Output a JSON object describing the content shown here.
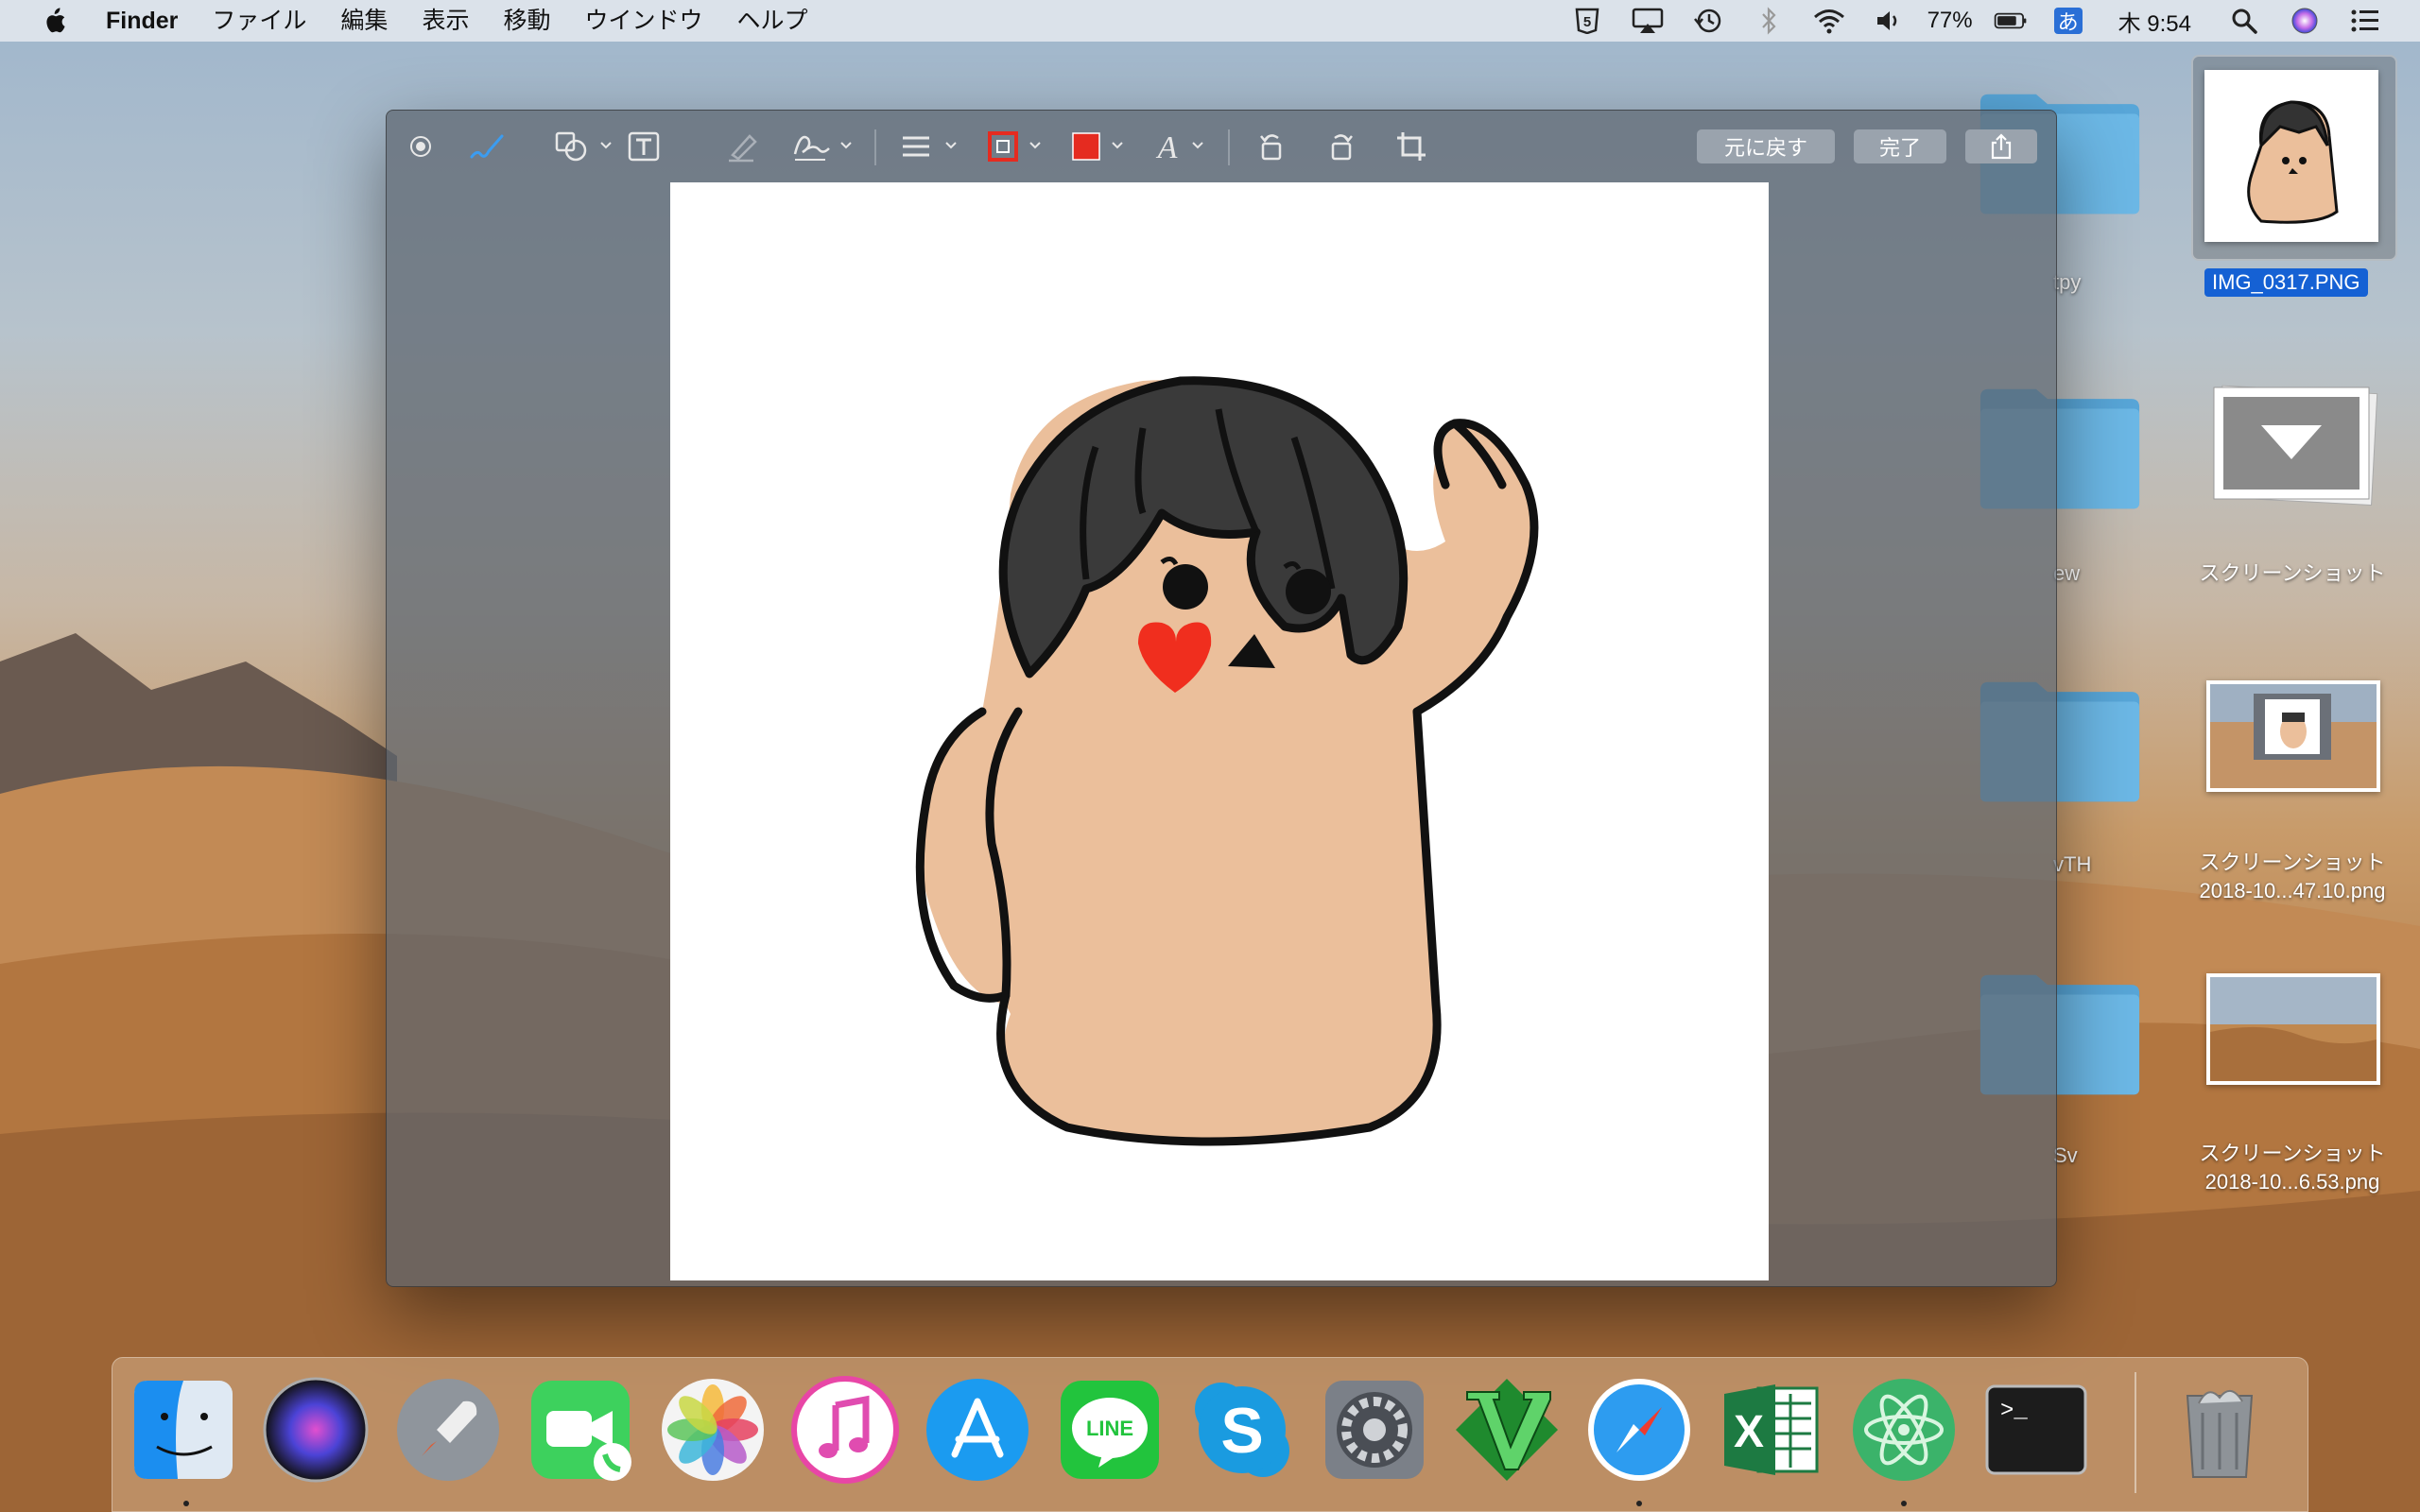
{
  "menubar": {
    "app_name": "Finder",
    "menus": [
      "ファイル",
      "編集",
      "表示",
      "移動",
      "ウインドウ",
      "ヘルプ"
    ],
    "status": {
      "battery_percent": "77%",
      "ime_label": "あ",
      "clock": "木 9:54"
    },
    "status_icons": [
      "s5-icon",
      "airplay-icon",
      "time-machine-icon",
      "bluetooth-icon",
      "wifi-icon",
      "volume-icon",
      "battery-icon",
      "input-method-icon",
      "search-icon",
      "siri-icon",
      "notification-center-icon"
    ]
  },
  "preview_window": {
    "toolbar": {
      "tools": [
        "selection-tool-icon",
        "sketch-tool-icon",
        "shapes-tool-icon",
        "text-tool-icon",
        "highlight-tool-icon",
        "sign-tool-icon",
        "line-style-icon",
        "border-color-icon",
        "fill-color-icon",
        "text-style-icon",
        "rotate-left-icon",
        "rotate-right-icon",
        "crop-icon"
      ],
      "revert_label": "元に戻す",
      "done_label": "完了",
      "share_icon": "share-icon"
    },
    "colors": {
      "border_color": "#e52b20",
      "fill_color": "#e52b20",
      "accent": "#3b9cf0"
    }
  },
  "desktop": {
    "folders": [
      {
        "label": "tpy"
      },
      {
        "label": "ew"
      },
      {
        "label": "vTH"
      },
      {
        "label": "Sv"
      }
    ],
    "files": [
      {
        "name": "IMG_0317.PNG",
        "selected": true
      },
      {
        "name": "スクリーンショット"
      },
      {
        "name_line1": "スクリーンショット",
        "name_line2": "2018-10...47.10.png"
      },
      {
        "name_line1": "スクリーンショット",
        "name_line2": "2018-10...6.53.png"
      }
    ]
  },
  "dock": {
    "apps": [
      "Finder",
      "Siri",
      "Launchpad",
      "FaceTime",
      "Photos",
      "iTunes",
      "App Store",
      "LINE",
      "Skype",
      "System Preferences",
      "Vim",
      "Safari",
      "Excel",
      "Atom",
      "Terminal",
      "Trash"
    ],
    "line_label": "LINE",
    "terminal_prompt": ">_"
  }
}
